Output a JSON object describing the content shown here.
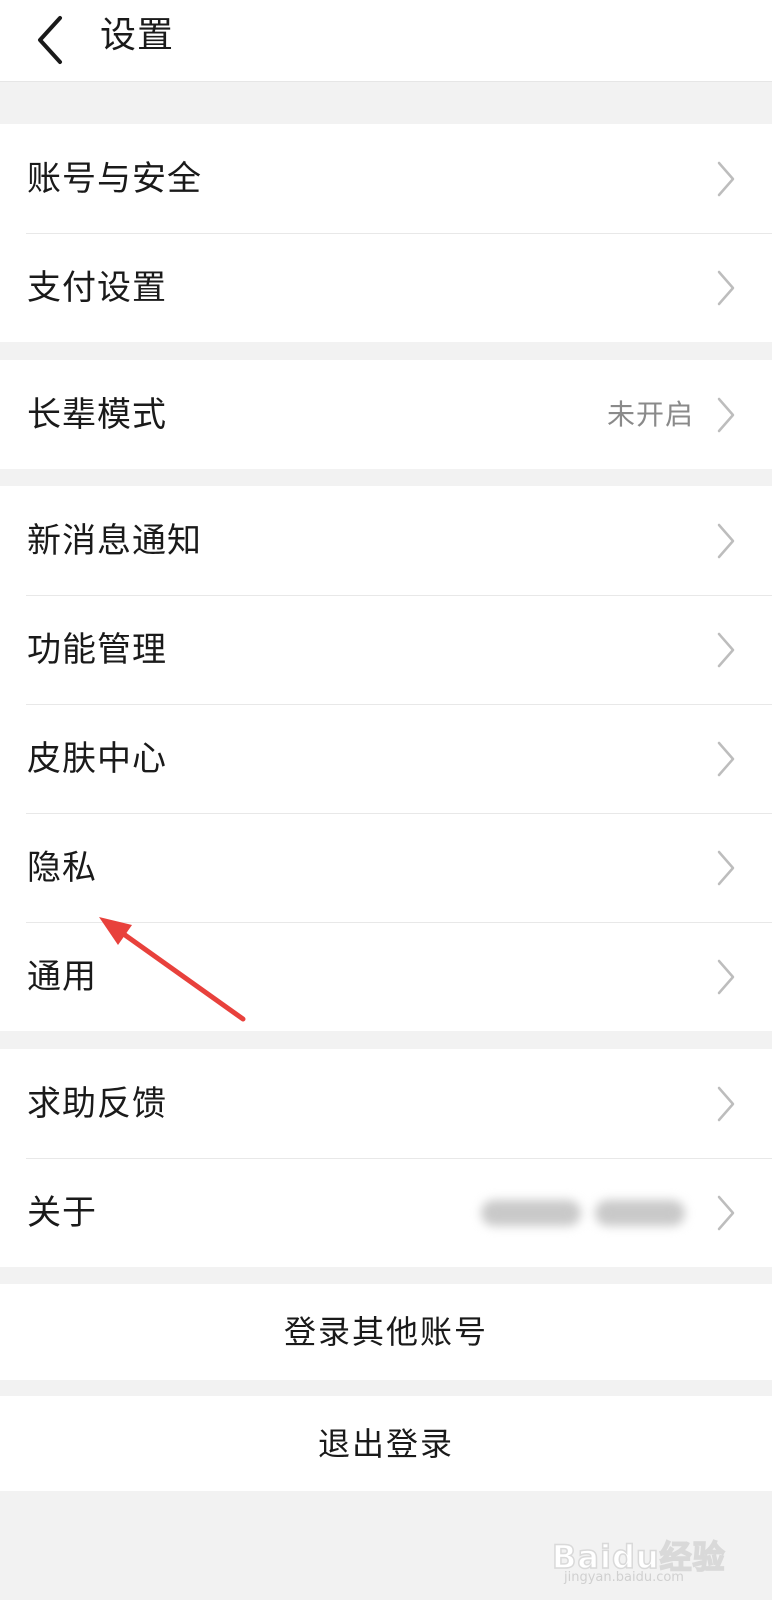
{
  "header": {
    "back_icon": "chevron-left-icon",
    "title": "设置"
  },
  "groups": [
    {
      "items": [
        {
          "label": "账号与安全"
        },
        {
          "label": "支付设置"
        }
      ]
    },
    {
      "items": [
        {
          "label": "长辈模式",
          "value": "未开启"
        }
      ]
    },
    {
      "items": [
        {
          "label": "新消息通知"
        },
        {
          "label": "功能管理"
        },
        {
          "label": "皮肤中心"
        },
        {
          "label": "隐私"
        },
        {
          "label": "通用"
        }
      ]
    },
    {
      "items": [
        {
          "label": "求助反馈"
        },
        {
          "label": "关于",
          "value_blurred": true
        }
      ]
    }
  ],
  "actions": {
    "switch_account": "登录其他账号",
    "logout": "退出登录"
  },
  "annotation": {
    "color": "#e8413c",
    "points_to": "隐私"
  },
  "watermark": {
    "logo": "Baidu经验",
    "site": "jingyan.baidu.com"
  },
  "colors": {
    "background": "#f2f2f2",
    "surface": "#ffffff",
    "text": "#1a1a1a",
    "secondary_text": "#8a8a8a",
    "divider": "#e8e8e8",
    "chevron": "#bdbdbd"
  }
}
